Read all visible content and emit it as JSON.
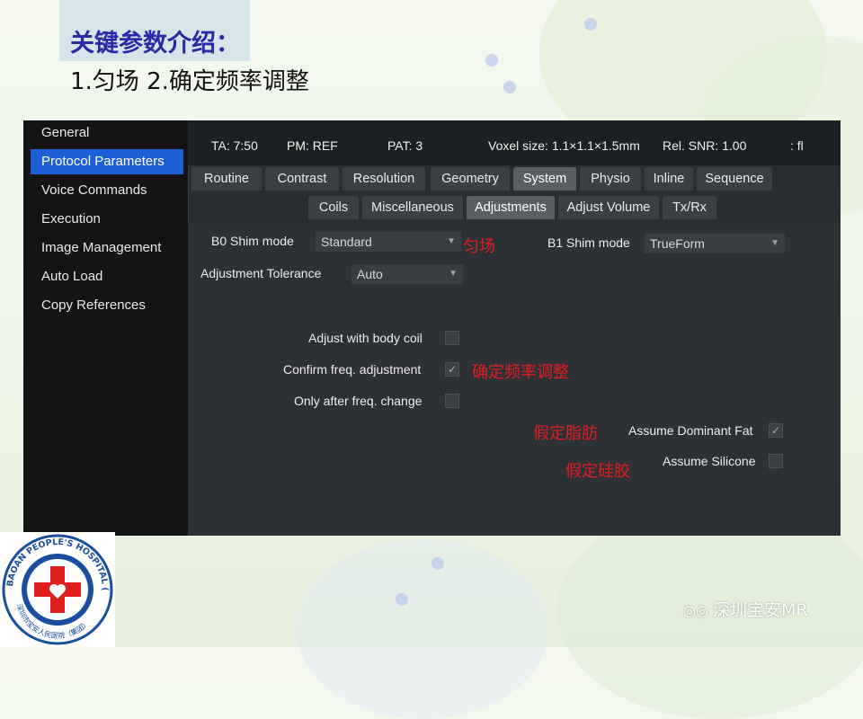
{
  "slide": {
    "title": "关键参数介绍：",
    "subtitle": "1.匀场  2.确定频率调整"
  },
  "sidebar": {
    "items": [
      {
        "label": "General",
        "active": false
      },
      {
        "label": "Protocol Parameters",
        "active": true
      },
      {
        "label": "Voice Commands",
        "active": false
      },
      {
        "label": "Execution",
        "active": false
      },
      {
        "label": "Image Management",
        "active": false
      },
      {
        "label": "Auto Load",
        "active": false
      },
      {
        "label": "Copy References",
        "active": false
      }
    ]
  },
  "status": {
    "ta": "TA: 7:50",
    "pm": "PM: REF",
    "pat": "PAT: 3",
    "voxel": "Voxel size: 1.1×1.1×1.5mm",
    "snr": "Rel. SNR: 1.00",
    "extra": ": fl"
  },
  "tabs_row1": [
    "Routine",
    "Contrast",
    "Resolution",
    "Geometry",
    "System",
    "Physio",
    "Inline",
    "Sequence"
  ],
  "tabs_row2": [
    "Coils",
    "Miscellaneous",
    "Adjustments",
    "Adjust Volume",
    "Tx/Rx"
  ],
  "active_tab1": "System",
  "active_tab2": "Adjustments",
  "params": {
    "b0_label": "B0 Shim mode",
    "b0_value": "Standard",
    "b1_label": "B1 Shim mode",
    "b1_value": "TrueForm",
    "tol_label": "Adjustment Tolerance",
    "tol_value": "Auto",
    "body_coil_label": "Adjust with body coil",
    "confirm_label": "Confirm freq. adjustment",
    "only_after_label": "Only after freq. change",
    "dominant_fat_label": "Assume Dominant Fat",
    "silicone_label": "Assume Silicone"
  },
  "checks": {
    "body_coil": false,
    "confirm": true,
    "only_after": false,
    "dominant_fat": true,
    "silicone": false
  },
  "annotations": {
    "shim": "匀场",
    "confirm": "确定频率调整",
    "fat": "假定脂肪",
    "silicone": "假定硅胶"
  },
  "logo": {
    "ring_text": "BAOAN PEOPLE'S HOSPITAL (GROUP)",
    "bottom_text": "深圳市宝安人民医院（集团）"
  },
  "watermark": "深圳宝安MR",
  "colors": {
    "title": "#2a2aa6",
    "active_item": "#1f5fd6",
    "annotation": "#e02020"
  }
}
